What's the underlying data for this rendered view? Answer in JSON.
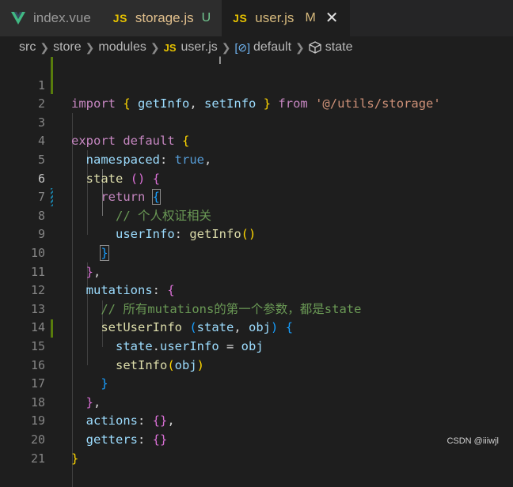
{
  "tabs": [
    {
      "name": "index.vue",
      "icon": "vue-icon",
      "mark": ""
    },
    {
      "name": "storage.js",
      "icon": "js-icon",
      "icon_label": "JS",
      "mark": "U"
    },
    {
      "name": "user.js",
      "icon": "js-icon",
      "icon_label": "JS",
      "mark": "M",
      "active": true
    }
  ],
  "breadcrumb": {
    "items": [
      "src",
      "store",
      "modules",
      "user.js",
      "default",
      "state"
    ],
    "js_label": "JS"
  },
  "editor": {
    "line_numbers": [
      "1",
      "2",
      "3",
      "4",
      "5",
      "6",
      "7",
      "8",
      "9",
      "10",
      "11",
      "12",
      "13",
      "14",
      "15",
      "16",
      "17",
      "18",
      "19",
      "20",
      "21"
    ],
    "current_line": 6
  },
  "code_tokens": {
    "import": "import",
    "getInfo": "getInfo",
    "setInfo": "setInfo",
    "from": "from",
    "path": "'@/utils/storage'",
    "export": "export",
    "default": "default",
    "namespaced": "namespaced",
    "true": "true",
    "state": "state",
    "return": "return",
    "comment1": "// 个人权证相关",
    "userInfo": "userInfo",
    "mutations": "mutations",
    "comment2": "// 所有mutations的第一个参数，都是state",
    "setUserInfo": "setUserInfo",
    "obj": "obj",
    "actions": "actions",
    "getters": "getters"
  },
  "watermark": "CSDN @iiiwjl",
  "colors": {
    "keyword": "#c586c0",
    "builtin": "#569cd6",
    "function": "#dcdcaa",
    "variable": "#9cdcfe",
    "string": "#ce9178",
    "comment": "#6a9955",
    "bracket_gold": "#ffd700",
    "bracket_purple": "#da70d6",
    "bracket_blue": "#179fff",
    "js_icon": "#e5c100",
    "vue_icon": "#41b883"
  }
}
